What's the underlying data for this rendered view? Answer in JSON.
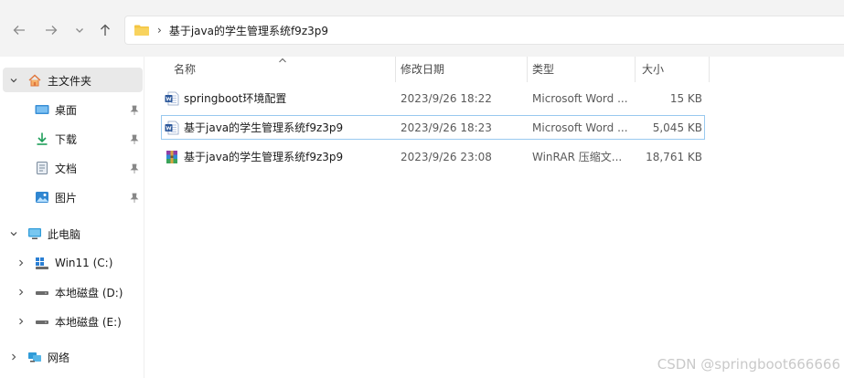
{
  "navigation": {
    "breadcrumb_separator": "›",
    "current_folder": "基于java的学生管理系统f9z3p9"
  },
  "sidebar": {
    "home": "主文件夹",
    "quick_access": [
      {
        "label": "桌面",
        "icon": "desktop-icon"
      },
      {
        "label": "下载",
        "icon": "download-icon"
      },
      {
        "label": "文档",
        "icon": "document-icon"
      },
      {
        "label": "图片",
        "icon": "pictures-icon"
      }
    ],
    "this_pc": "此电脑",
    "drives": [
      {
        "label": "Win11 (C:)",
        "icon": "windows-drive-icon"
      },
      {
        "label": "本地磁盘 (D:)",
        "icon": "disk-drive-icon"
      },
      {
        "label": "本地磁盘 (E:)",
        "icon": "disk-drive-icon"
      }
    ],
    "network": "网络"
  },
  "columns": {
    "name": "名称",
    "date": "修改日期",
    "type": "类型",
    "size": "大小"
  },
  "files": [
    {
      "name": "springboot环境配置",
      "date": "2023/9/26 18:22",
      "type": "Microsoft Word ...",
      "size": "15 KB",
      "icon": "word-file-icon",
      "selected": false
    },
    {
      "name": "基于java的学生管理系统f9z3p9",
      "date": "2023/9/26 18:23",
      "type": "Microsoft Word ...",
      "size": "5,045 KB",
      "icon": "word-file-icon",
      "selected": true
    },
    {
      "name": "基于java的学生管理系统f9z3p9",
      "date": "2023/9/26 23:08",
      "type": "WinRAR 压缩文...",
      "size": "18,761 KB",
      "icon": "winrar-archive-icon",
      "selected": false
    }
  ],
  "watermark": "CSDN @springboot666666",
  "colors": {
    "selection_border": "#99c9ef",
    "folder_yellow": "#f4c542",
    "word_blue": "#2b579a"
  }
}
